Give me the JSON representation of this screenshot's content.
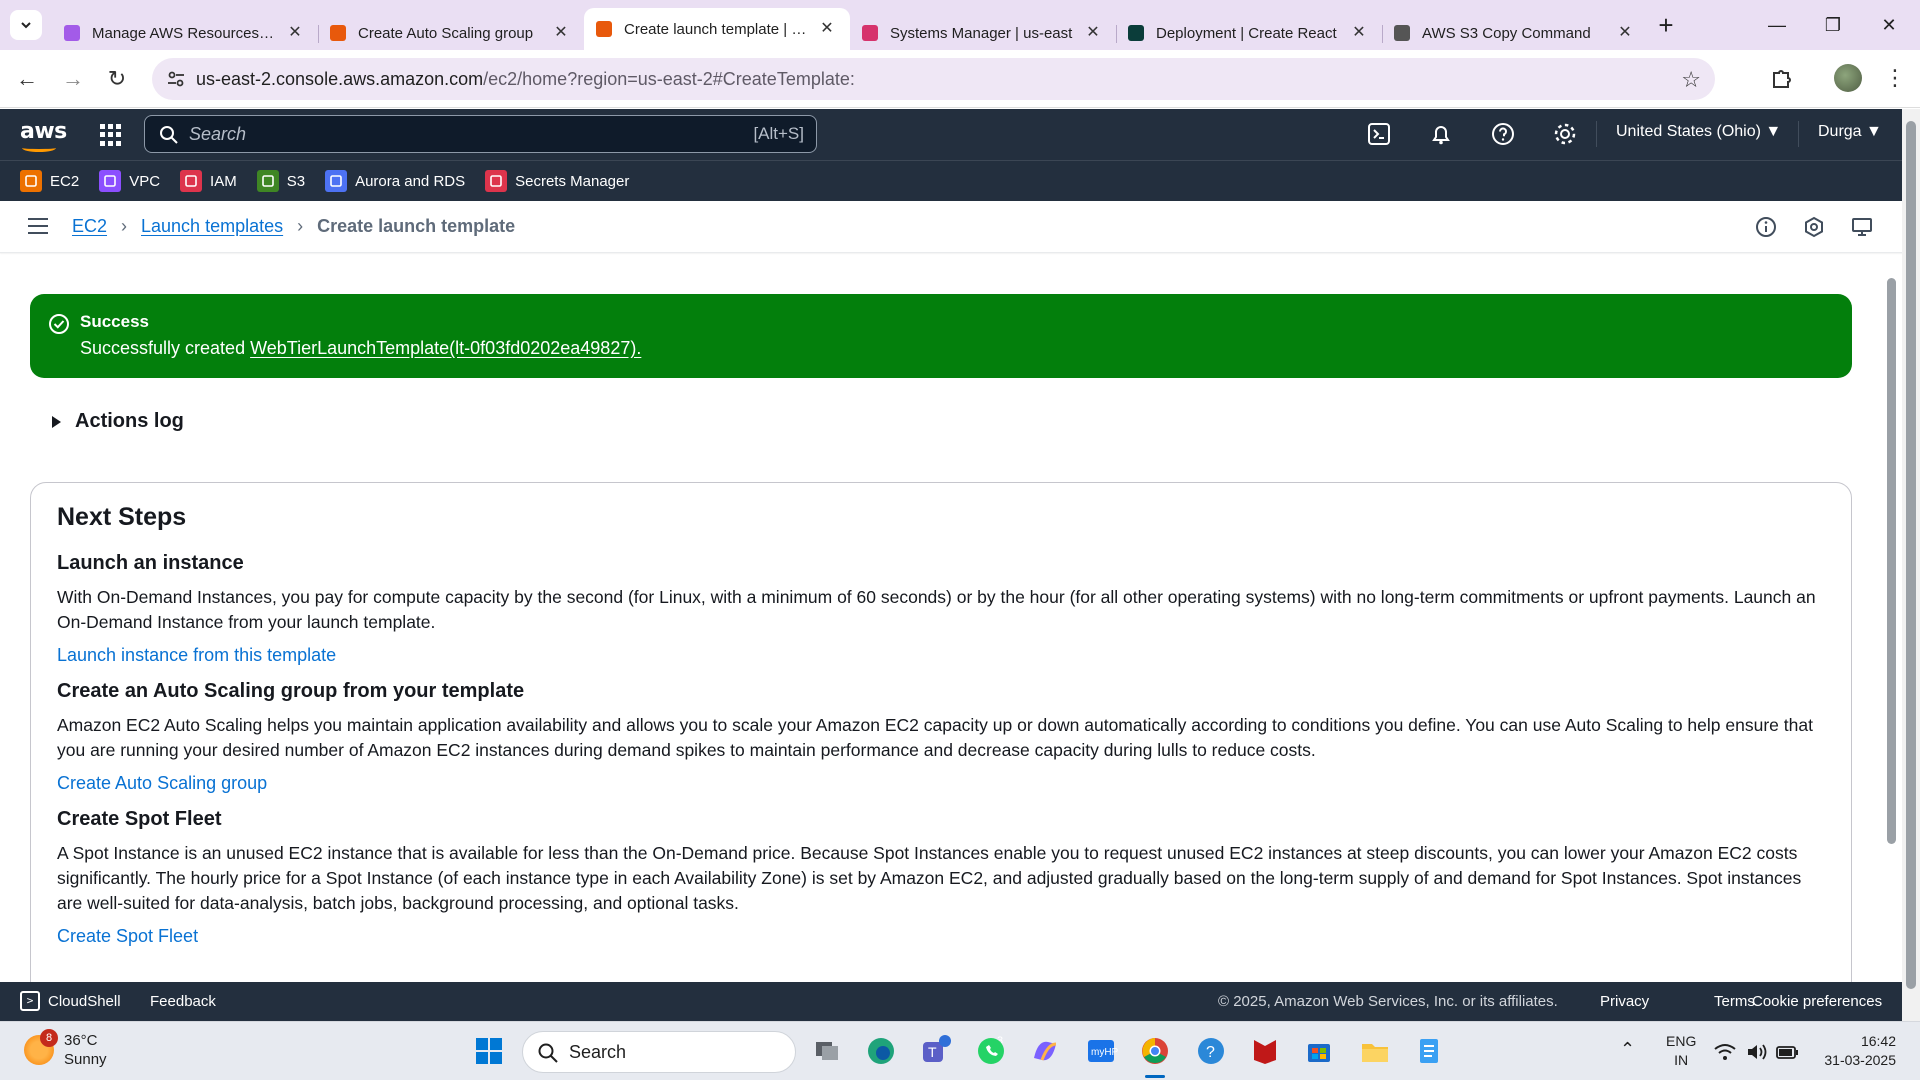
{
  "browser": {
    "tabs": [
      {
        "title": "Manage AWS Resources - A",
        "favicon_color": "#a35be8",
        "active": false
      },
      {
        "title": "Create Auto Scaling group",
        "favicon_color": "#e8590c",
        "active": false
      },
      {
        "title": "Create launch template | EC",
        "favicon_color": "#e8590c",
        "active": true
      },
      {
        "title": "Systems Manager | us-east",
        "favicon_color": "#d6336c",
        "active": false
      },
      {
        "title": "Deployment | Create React",
        "favicon_color": "#0b3d3a",
        "active": false
      },
      {
        "title": "AWS S3 Copy Command",
        "favicon_color": "#555555",
        "active": false
      }
    ],
    "url_host": "us-east-2.console.aws.amazon.com",
    "url_path": "/ec2/home?region=us-east-2#CreateTemplate:"
  },
  "aws_header": {
    "logo_text": "aws",
    "search_placeholder": "Search",
    "search_shortcut": "[Alt+S]",
    "region": "United States (Ohio) ▼",
    "user": "Durga ▼"
  },
  "favorites": [
    {
      "label": "EC2",
      "color": "#ed7100"
    },
    {
      "label": "VPC",
      "color": "#8c4fff"
    },
    {
      "label": "IAM",
      "color": "#dd344c"
    },
    {
      "label": "S3",
      "color": "#3f8624"
    },
    {
      "label": "Aurora and RDS",
      "color": "#4d72f3"
    },
    {
      "label": "Secrets Manager",
      "color": "#dd344c"
    }
  ],
  "breadcrumb": {
    "items": [
      "EC2",
      "Launch templates"
    ],
    "current": "Create launch template"
  },
  "flash": {
    "title": "Success",
    "message_prefix": "Successfully created ",
    "link_text": "WebTierLaunchTemplate(lt-0f03fd0202ea49827).",
    "color": "#037f0c"
  },
  "actions_log": "Actions log",
  "next_steps": {
    "title": "Next Steps",
    "sections": [
      {
        "heading": "Launch an instance",
        "text": "With On-Demand Instances, you pay for compute capacity by the second (for Linux, with a minimum of 60 seconds) or by the hour (for all other operating systems) with no long-term commitments or upfront payments. Launch an On-Demand Instance from your launch template.",
        "link": "Launch instance from this template"
      },
      {
        "heading": "Create an Auto Scaling group from your template",
        "text": "Amazon EC2 Auto Scaling helps you maintain application availability and allows you to scale your Amazon EC2 capacity up or down automatically according to conditions you define. You can use Auto Scaling to help ensure that you are running your desired number of Amazon EC2 instances during demand spikes to maintain performance and decrease capacity during lulls to reduce costs.",
        "link": "Create Auto Scaling group"
      },
      {
        "heading": "Create Spot Fleet",
        "text": "A Spot Instance is an unused EC2 instance that is available for less than the On-Demand price. Because Spot Instances enable you to request unused EC2 instances at steep discounts, you can lower your Amazon EC2 costs significantly. The hourly price for a Spot Instance (of each instance type in each Availability Zone) is set by Amazon EC2, and adjusted gradually based on the long-term supply of and demand for Spot Instances. Spot instances are well-suited for data-analysis, batch jobs, background processing, and optional tasks.",
        "link": "Create Spot Fleet"
      }
    ]
  },
  "aws_footer": {
    "cloudshell": "CloudShell",
    "feedback": "Feedback",
    "copyright": "© 2025, Amazon Web Services, Inc. or its affiliates.",
    "privacy": "Privacy",
    "terms": "Terms",
    "cookies": "Cookie preferences"
  },
  "taskbar": {
    "weather_badge": "8",
    "temperature": "36°C",
    "condition": "Sunny",
    "search": "Search",
    "teams_badge": "3",
    "lang_1": "ENG",
    "lang_2": "IN",
    "time": "16:42",
    "date": "31-03-2025"
  }
}
